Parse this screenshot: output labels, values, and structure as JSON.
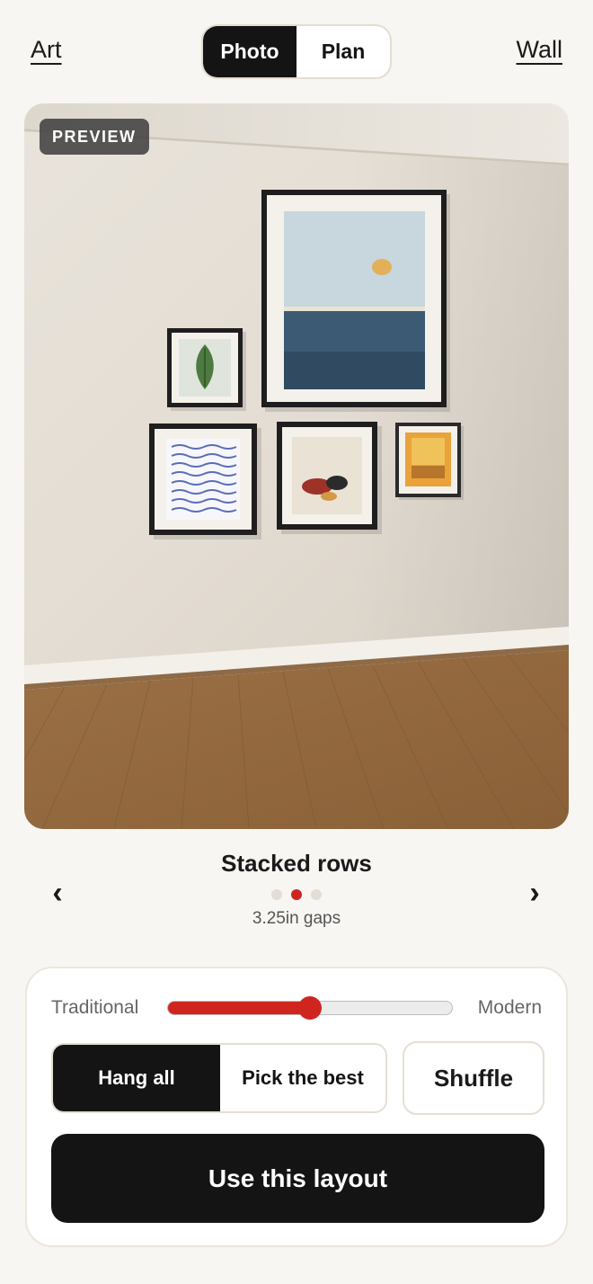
{
  "nav": {
    "left_link": "Art",
    "right_link": "Wall",
    "view_toggle": {
      "options": [
        "Photo",
        "Plan"
      ],
      "selected": "Photo"
    }
  },
  "preview": {
    "badge": "PREVIEW",
    "artworks": [
      "leaf-print",
      "seascape-print",
      "wave-lines-print",
      "stones-print",
      "yellow-block-print"
    ]
  },
  "layout_selector": {
    "title": "Stacked rows",
    "subtitle": "3.25in gaps",
    "prev_icon": "‹",
    "next_icon": "›",
    "page_count": 3,
    "active_page": 2
  },
  "controls": {
    "style_slider": {
      "min_label": "Traditional",
      "max_label": "Modern",
      "value_fraction": 0.5
    },
    "mode_toggle": {
      "options": [
        "Hang all",
        "Pick the best"
      ],
      "selected": "Hang all"
    },
    "shuffle_label": "Shuffle",
    "primary_label": "Use this layout"
  },
  "colors": {
    "accent": "#d0251f",
    "dark": "#141414",
    "background": "#f8f6f2"
  }
}
